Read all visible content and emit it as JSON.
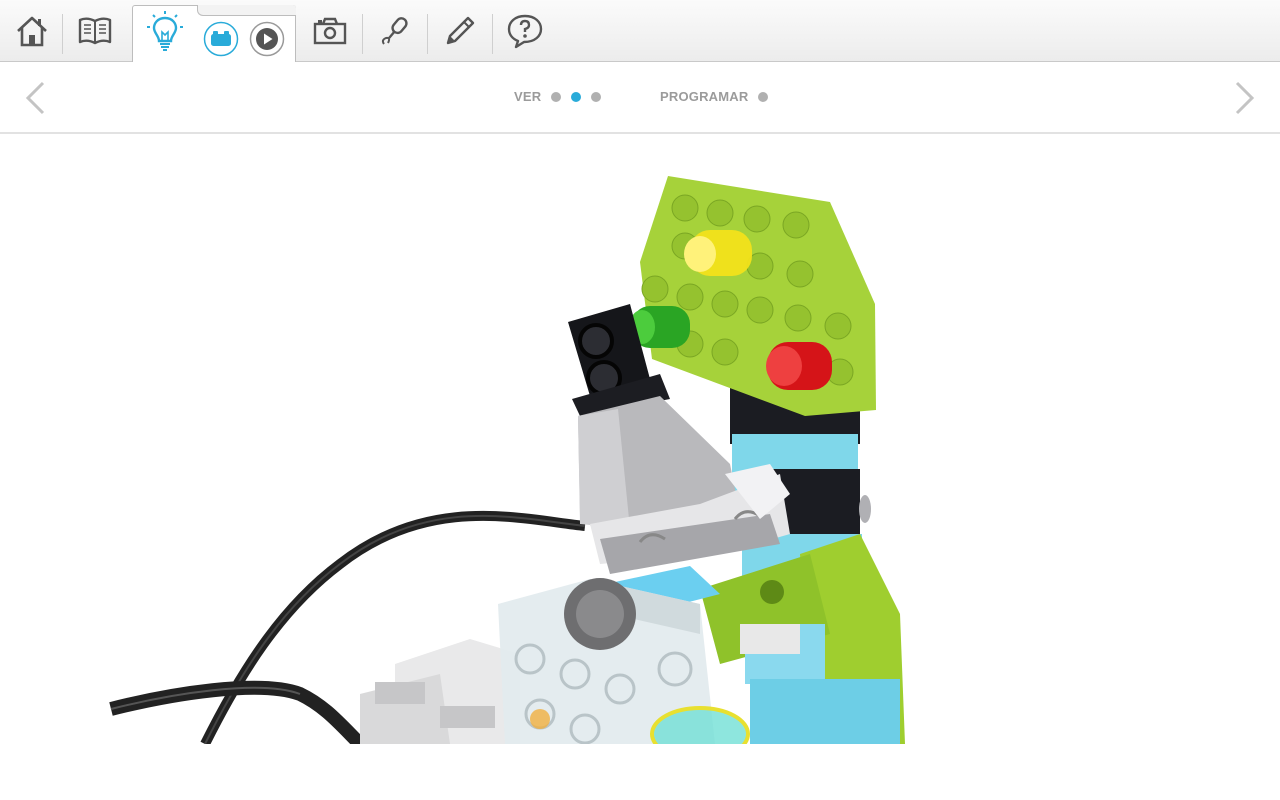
{
  "toolbar": {
    "items": [
      {
        "name": "home",
        "icon": "home-icon"
      },
      {
        "name": "book",
        "icon": "book-icon"
      },
      {
        "name": "idea",
        "icon": "lightbulb-icon",
        "active": true
      },
      {
        "name": "build",
        "icon": "brick-icon"
      },
      {
        "name": "play",
        "icon": "play-icon"
      },
      {
        "name": "camera",
        "icon": "camera-icon"
      },
      {
        "name": "record",
        "icon": "microphone-icon"
      },
      {
        "name": "write",
        "icon": "pencil-icon"
      },
      {
        "name": "help",
        "icon": "help-icon"
      }
    ],
    "accent_color": "#29abd9"
  },
  "steps": {
    "ver": {
      "label": "VER",
      "dots": [
        false,
        true,
        false
      ]
    },
    "programar": {
      "label": "PROGRAMAR",
      "dots": [
        false
      ]
    }
  },
  "nav": {
    "prev_icon": "chevron-left-icon",
    "next_icon": "chevron-right-icon"
  },
  "main": {
    "image": "lego-model-render"
  }
}
